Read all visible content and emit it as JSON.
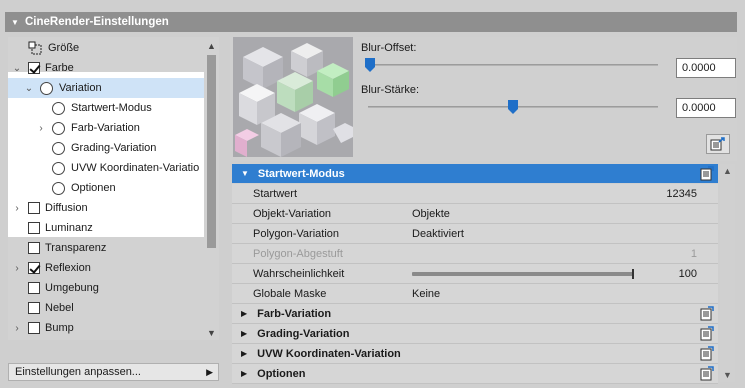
{
  "window": {
    "title": "CineRender-Einstellungen"
  },
  "tree": {
    "items": [
      {
        "label": "Größe",
        "indent": 0,
        "type": "icon",
        "checked": null,
        "arrow": "",
        "selected": false
      },
      {
        "label": "Farbe",
        "indent": 0,
        "type": "checkbox",
        "checked": true,
        "arrow": "▼",
        "selected": false
      },
      {
        "label": "Variation",
        "indent": 1,
        "type": "radio",
        "checked": null,
        "arrow": "▼",
        "selected": true
      },
      {
        "label": "Startwert-Modus",
        "indent": 2,
        "type": "radio",
        "checked": null,
        "arrow": "",
        "selected": false
      },
      {
        "label": "Farb-Variation",
        "indent": 2,
        "type": "radio",
        "checked": null,
        "arrow": "›",
        "selected": false
      },
      {
        "label": "Grading-Variation",
        "indent": 2,
        "type": "radio",
        "checked": null,
        "arrow": "",
        "selected": false
      },
      {
        "label": "UVW Koordinaten-Variatio",
        "indent": 2,
        "type": "radio",
        "checked": null,
        "arrow": "",
        "selected": false
      },
      {
        "label": "Optionen",
        "indent": 2,
        "type": "radio",
        "checked": null,
        "arrow": "",
        "selected": false
      },
      {
        "label": "Diffusion",
        "indent": 0,
        "type": "checkbox",
        "checked": false,
        "arrow": "›",
        "selected": false
      },
      {
        "label": "Luminanz",
        "indent": 0,
        "type": "checkbox",
        "checked": false,
        "arrow": "",
        "selected": false
      },
      {
        "label": "Transparenz",
        "indent": 0,
        "type": "checkbox",
        "checked": false,
        "arrow": "",
        "selected": false
      },
      {
        "label": "Reflexion",
        "indent": 0,
        "type": "checkbox",
        "checked": true,
        "arrow": "›",
        "selected": false
      },
      {
        "label": "Umgebung",
        "indent": 0,
        "type": "checkbox",
        "checked": false,
        "arrow": "",
        "selected": false
      },
      {
        "label": "Nebel",
        "indent": 0,
        "type": "checkbox",
        "checked": false,
        "arrow": "",
        "selected": false
      },
      {
        "label": "Bump",
        "indent": 0,
        "type": "checkbox",
        "checked": false,
        "arrow": "›",
        "selected": false
      }
    ],
    "footer_label": "Einstellungen anpassen..."
  },
  "preview": {
    "blur_offset_label": "Blur-Offset:",
    "blur_offset_value": "0.0000",
    "blur_offset_level": 0.0,
    "blur_strength_label": "Blur-Stärke:",
    "blur_strength_value": "0.0000",
    "blur_strength_level": 0.5
  },
  "section": {
    "title": "Startwert-Modus",
    "rows": [
      {
        "name": "Startwert",
        "value": "",
        "num": "12345",
        "disabled": false
      },
      {
        "name": "Objekt-Variation",
        "value": "Objekte",
        "num": "",
        "disabled": false
      },
      {
        "name": "Polygon-Variation",
        "value": "Deaktiviert",
        "num": "",
        "disabled": false
      },
      {
        "name": "Polygon-Abgestuft",
        "value": "",
        "num": "1",
        "disabled": true
      },
      {
        "name": "Wahrscheinlichkeit",
        "value": "",
        "num": "100",
        "disabled": false,
        "slider_level": 1.0
      },
      {
        "name": "Globale Maske",
        "value": "Keine",
        "num": "",
        "disabled": false
      }
    ]
  },
  "collapsed_sections": [
    {
      "title": "Farb-Variation"
    },
    {
      "title": "Grading-Variation"
    },
    {
      "title": "UVW Koordinaten-Variation"
    },
    {
      "title": "Optionen"
    }
  ],
  "colors": {
    "accent": "#2f7ed0",
    "selected_row": "#cfe3f7"
  }
}
